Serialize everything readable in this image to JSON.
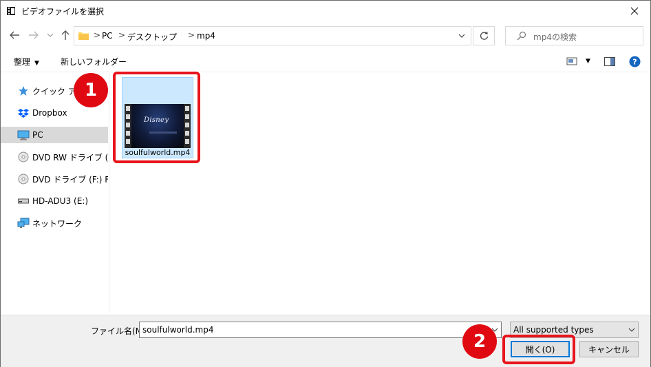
{
  "window": {
    "title": "ビデオファイルを選択",
    "close_icon": "close-icon",
    "app_icon": "app-icon"
  },
  "address": {
    "crumbs": [
      "PC",
      "デスクトップ",
      "mp4"
    ],
    "separator": ">",
    "search_placeholder": "mp4の検索"
  },
  "toolbar": {
    "organize_label": "整理",
    "new_folder_label": "新しいフォルダー"
  },
  "sidebar": {
    "items": [
      {
        "label": "クイック アクセス",
        "icon": "star-icon"
      },
      {
        "label": "Dropbox",
        "icon": "dropbox-icon"
      },
      {
        "label": "PC",
        "icon": "computer-icon",
        "selected": true
      },
      {
        "label": "DVD RW ドライブ (D:) F",
        "icon": "disc-icon"
      },
      {
        "label": "DVD ドライブ (F:) FROZ",
        "icon": "disc-icon"
      },
      {
        "label": "HD-ADU3 (E:)",
        "icon": "drive-icon"
      },
      {
        "label": "ネットワーク",
        "icon": "network-icon"
      }
    ]
  },
  "content": {
    "file": {
      "name": "soulfulworld.mp4",
      "thumbnail_text": "Disney"
    }
  },
  "bottom": {
    "filename_label": "ファイル名(N):",
    "filename_value": "soulfulworld.mp4",
    "filetype_value": "All supported types",
    "open_label": "開く(O)",
    "cancel_label": "キャンセル"
  },
  "callouts": {
    "step1": "1",
    "step2": "2",
    "color": "#e00912"
  }
}
